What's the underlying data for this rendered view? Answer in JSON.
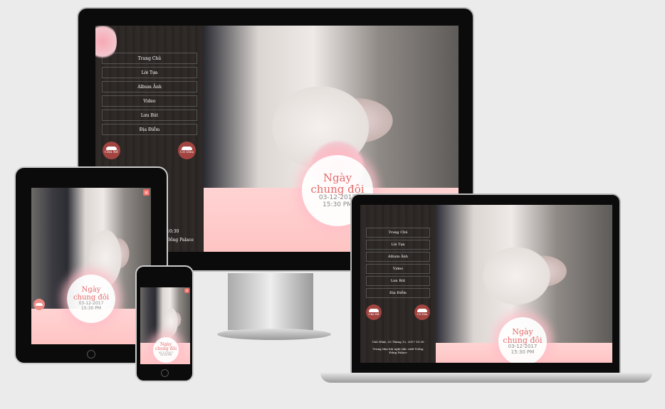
{
  "site": {
    "menu": [
      "Trang Chủ",
      "Lời Tựa",
      "Album Ảnh",
      "Video",
      "Lưu Bút",
      "Địa Điểm"
    ],
    "groom_label": "Chú Rể",
    "bride_label": "Cô Dâu",
    "title": "Ngày chung đôi",
    "date": "03-12-2017",
    "time": "15:30 PM",
    "event_datetime": "Chủ Nhật, 03 Tháng 12, 2017 10:30",
    "venue": "Trung tâm hội nghị tiệc cưới Trống Đồng Palace",
    "monitor_partial_time": "10:30",
    "monitor_partial_venue": "Đồng Palace"
  },
  "icons": {
    "menu": "hamburger-icon",
    "groom": "mustache-icon",
    "bride": "tiara-icon"
  },
  "colors": {
    "accent": "#e46a6a",
    "button": "#a2443f",
    "pink": "#ffc9c9",
    "sidebar": "#2b2725"
  }
}
